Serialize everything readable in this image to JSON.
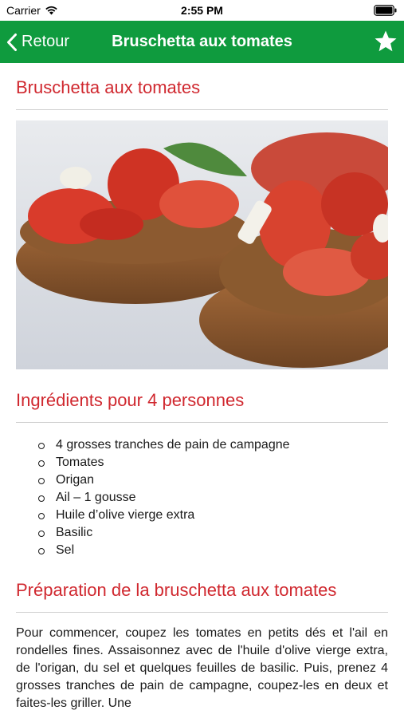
{
  "status_bar": {
    "carrier": "Carrier",
    "time": "2:55 PM"
  },
  "nav": {
    "back_label": "Retour",
    "title": "Bruschetta aux tomates",
    "background": "#0f9b3e"
  },
  "recipe": {
    "title": "Bruschetta aux tomates",
    "title_color": "#d0282f",
    "image_icon": "bruschetta-photo",
    "ingredients_heading": "Ingrédients pour 4 personnes",
    "ingredients": [
      "4 grosses tranches de pain de campagne",
      "Tomates",
      "Origan",
      "Ail – 1 gousse",
      "Huile d’olive vierge extra",
      "Basilic",
      "Sel"
    ],
    "preparation_heading": "Préparation de la bruschetta aux tomates",
    "preparation_text": "Pour commencer, coupez les tomates en petits dés et l'ail en rondelles fines. Assaisonnez avec de l'huile d'olive vierge extra, de l'origan, du sel et quelques feuilles de basilic. Puis, prenez 4 grosses tranches de pain de campagne, coupez-les en deux et faites-les griller. Une"
  }
}
